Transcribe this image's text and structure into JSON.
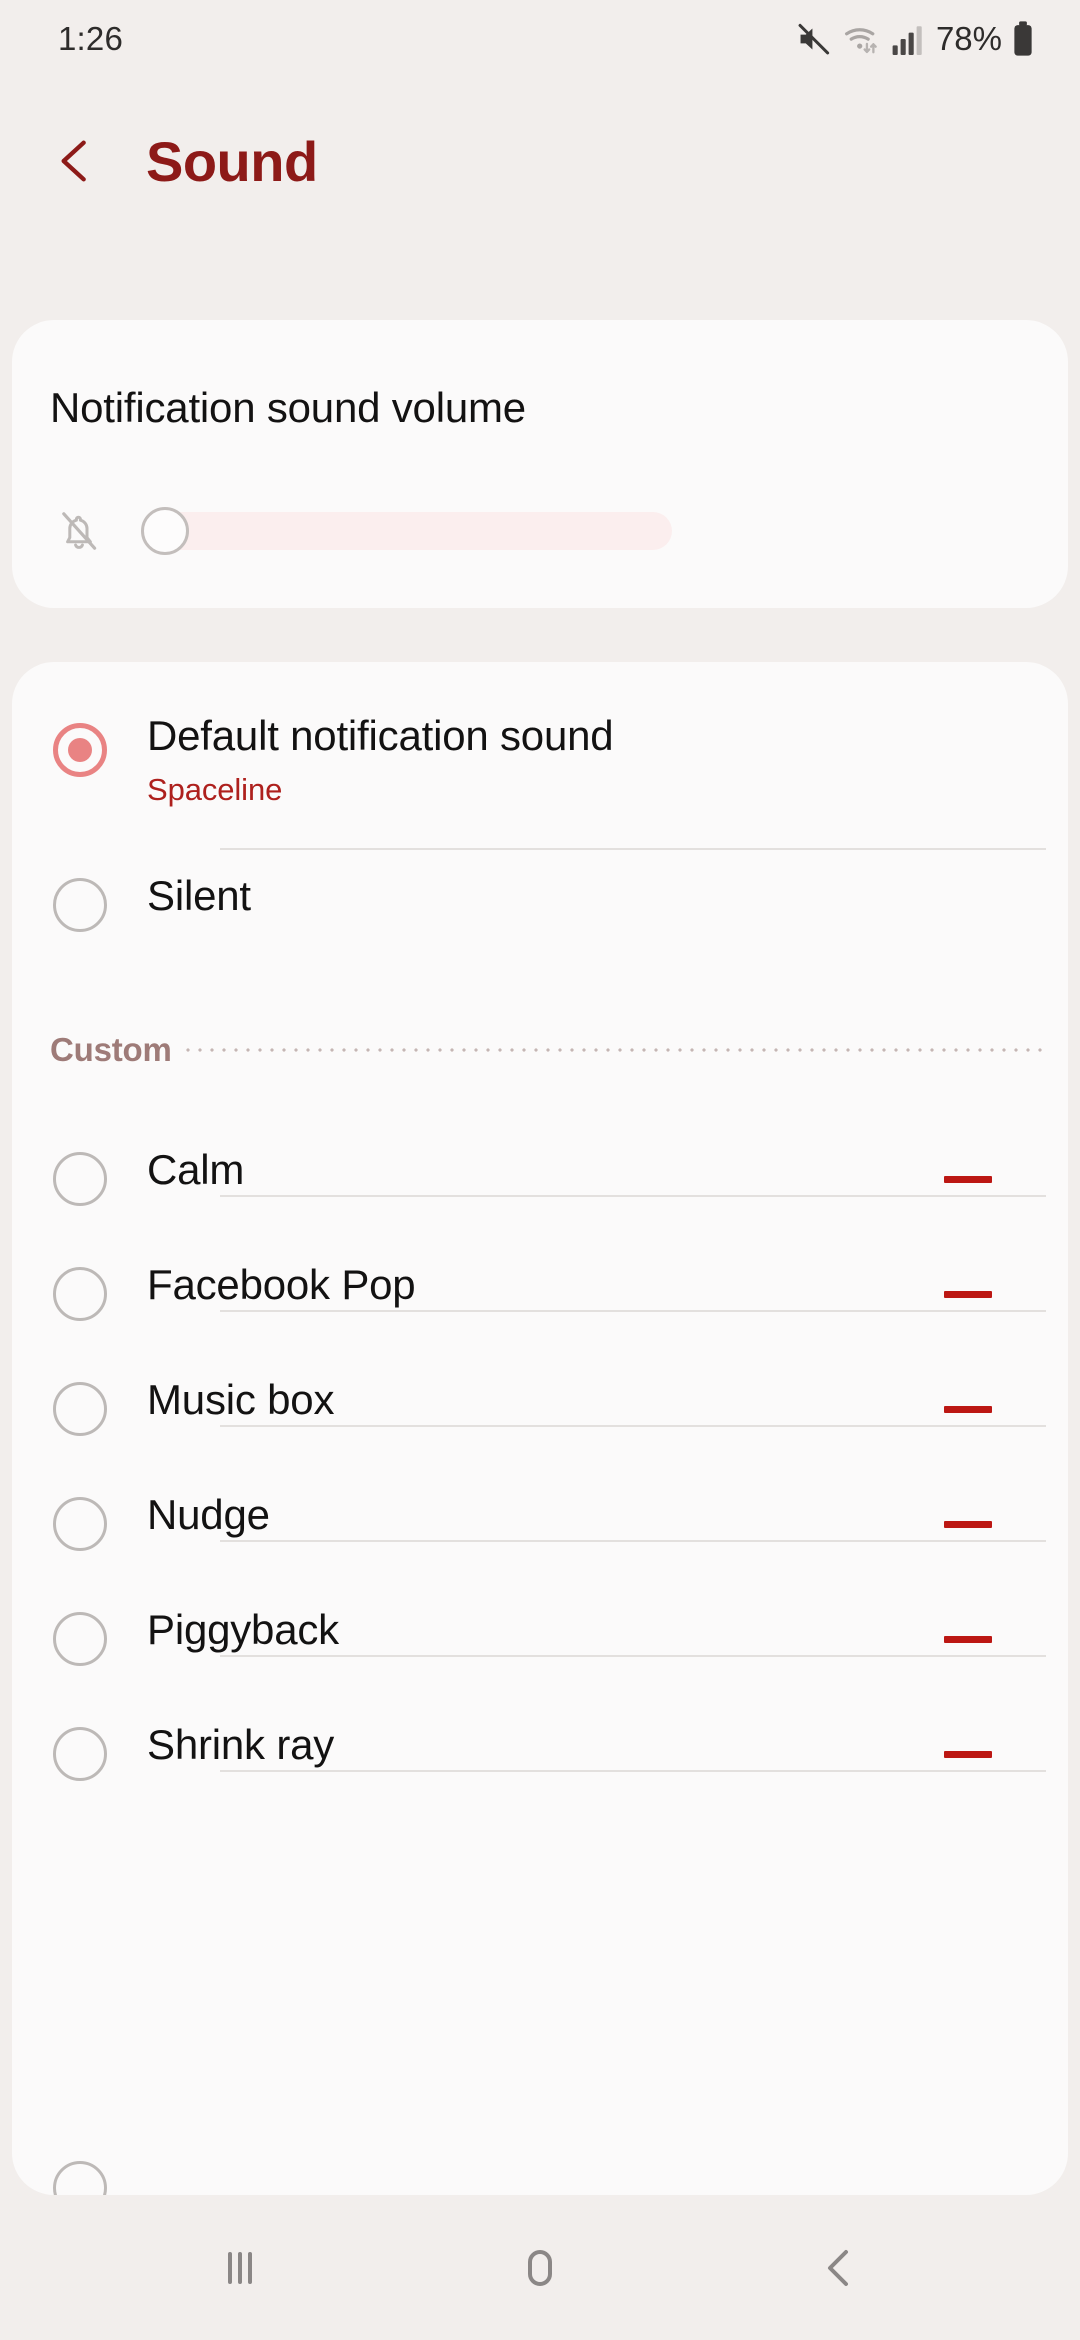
{
  "status_bar": {
    "time": "1:26",
    "battery_percent": "78%",
    "icons": {
      "mute": "volume-muted-icon",
      "wifi": "wifi-icon",
      "signal": "cellular-signal-icon",
      "battery": "battery-icon"
    }
  },
  "header": {
    "back_label": "back-chevron-icon",
    "title": "Sound",
    "accent_color": "#8d1a18"
  },
  "volume_card": {
    "title": "Notification sound volume",
    "icon": "bell-muted-icon",
    "slider": {
      "value": 0,
      "min": 0,
      "max": 15,
      "track_color": "#fbeeee",
      "fill_color": "#b2201c"
    }
  },
  "sound_list": {
    "primary": [
      {
        "label": "Default notification sound",
        "sublabel": "Spaceline",
        "selected": true,
        "removable": false
      },
      {
        "label": "Silent",
        "sublabel": "",
        "selected": false,
        "removable": false
      }
    ],
    "section": {
      "label": "Custom"
    },
    "custom": [
      {
        "label": "Calm",
        "selected": false,
        "removable": true
      },
      {
        "label": "Facebook Pop",
        "selected": false,
        "removable": true
      },
      {
        "label": "Music box",
        "selected": false,
        "removable": true
      },
      {
        "label": "Nudge",
        "selected": false,
        "removable": true
      },
      {
        "label": "Piggyback",
        "selected": false,
        "removable": true
      },
      {
        "label": "Shrink ray",
        "selected": false,
        "removable": true
      }
    ],
    "selected_radio_color": "#e98383",
    "remove_button_color": "#bc1713"
  },
  "nav_bar": {
    "recents": "recents-icon",
    "home": "home-icon",
    "back": "back-icon"
  }
}
